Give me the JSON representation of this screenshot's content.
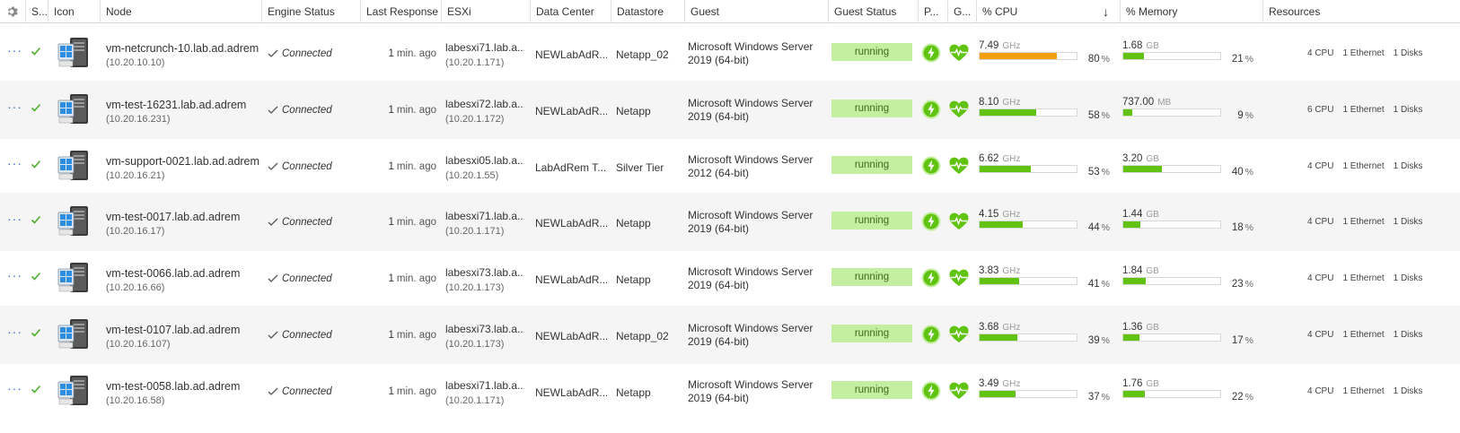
{
  "columns": {
    "s": "S...",
    "icon": "Icon",
    "node": "Node",
    "engine_status": "Engine Status",
    "last_response": "Last Response",
    "esxi": "ESXi",
    "data_center": "Data Center",
    "datastore": "Datastore",
    "guest": "Guest",
    "guest_status": "Guest Status",
    "p": "P...",
    "g": "G...",
    "cpu": "% CPU",
    "memory": "% Memory",
    "resources": "Resources"
  },
  "colors": {
    "bar_normal": "#5fc30f",
    "bar_warning": "#f29f10",
    "running_bg": "#c4eea0",
    "accent_green": "#5fc30f"
  },
  "row_menu_glyph": "···",
  "rows": [
    {
      "node_name": "vm-netcrunch-10.lab.ad.adrem",
      "node_ip": "(10.20.10.10)",
      "engine_status": "Connected",
      "last_response_num": "1",
      "last_response_unit": "min. ago",
      "esxi_name": "labesxi71.lab.a...",
      "esxi_ip": "(10.20.1.171)",
      "data_center": "NEWLabAdR...",
      "datastore": "Netapp_02",
      "guest_line1": "Microsoft Windows Server",
      "guest_line2": "2019 (64-bit)",
      "guest_status": "running",
      "cpu_value": "7.49",
      "cpu_unit": "GHz",
      "cpu_pct": "80",
      "cpu_level": 0.8,
      "cpu_warn": true,
      "mem_value": "1.68",
      "mem_unit": "GB",
      "mem_pct": "21",
      "mem_level": 0.21,
      "res_cpu": "4 CPU",
      "res_eth": "1 Ethernet",
      "res_disk": "1 Disks"
    },
    {
      "node_name": "vm-test-16231.lab.ad.adrem",
      "node_ip": "(10.20.16.231)",
      "engine_status": "Connected",
      "last_response_num": "1",
      "last_response_unit": "min. ago",
      "esxi_name": "labesxi72.lab.a...",
      "esxi_ip": "(10.20.1.172)",
      "data_center": "NEWLabAdR...",
      "datastore": "Netapp",
      "guest_line1": "Microsoft Windows Server",
      "guest_line2": "2019 (64-bit)",
      "guest_status": "running",
      "cpu_value": "8.10",
      "cpu_unit": "GHz",
      "cpu_pct": "58",
      "cpu_level": 0.58,
      "cpu_warn": false,
      "mem_value": "737.00",
      "mem_unit": "MB",
      "mem_pct": "9",
      "mem_level": 0.09,
      "res_cpu": "6 CPU",
      "res_eth": "1 Ethernet",
      "res_disk": "1 Disks"
    },
    {
      "node_name": "vm-support-0021.lab.ad.adrem",
      "node_ip": "(10.20.16.21)",
      "engine_status": "Connected",
      "last_response_num": "1",
      "last_response_unit": "min. ago",
      "esxi_name": "labesxi05.lab.a...",
      "esxi_ip": "(10.20.1.55)",
      "data_center": "LabAdRem T...",
      "datastore": "Silver Tier",
      "guest_line1": "Microsoft Windows Server",
      "guest_line2": "2012 (64-bit)",
      "guest_status": "running",
      "cpu_value": "6.62",
      "cpu_unit": "GHz",
      "cpu_pct": "53",
      "cpu_level": 0.53,
      "cpu_warn": false,
      "mem_value": "3.20",
      "mem_unit": "GB",
      "mem_pct": "40",
      "mem_level": 0.4,
      "res_cpu": "4 CPU",
      "res_eth": "1 Ethernet",
      "res_disk": "1 Disks"
    },
    {
      "node_name": "vm-test-0017.lab.ad.adrem",
      "node_ip": "(10.20.16.17)",
      "engine_status": "Connected",
      "last_response_num": "1",
      "last_response_unit": "min. ago",
      "esxi_name": "labesxi71.lab.a...",
      "esxi_ip": "(10.20.1.171)",
      "data_center": "NEWLabAdR...",
      "datastore": "Netapp",
      "guest_line1": "Microsoft Windows Server",
      "guest_line2": "2019 (64-bit)",
      "guest_status": "running",
      "cpu_value": "4.15",
      "cpu_unit": "GHz",
      "cpu_pct": "44",
      "cpu_level": 0.44,
      "cpu_warn": false,
      "mem_value": "1.44",
      "mem_unit": "GB",
      "mem_pct": "18",
      "mem_level": 0.18,
      "res_cpu": "4 CPU",
      "res_eth": "1 Ethernet",
      "res_disk": "1 Disks"
    },
    {
      "node_name": "vm-test-0066.lab.ad.adrem",
      "node_ip": "(10.20.16.66)",
      "engine_status": "Connected",
      "last_response_num": "1",
      "last_response_unit": "min. ago",
      "esxi_name": "labesxi73.lab.a...",
      "esxi_ip": "(10.20.1.173)",
      "data_center": "NEWLabAdR...",
      "datastore": "Netapp",
      "guest_line1": "Microsoft Windows Server",
      "guest_line2": "2019 (64-bit)",
      "guest_status": "running",
      "cpu_value": "3.83",
      "cpu_unit": "GHz",
      "cpu_pct": "41",
      "cpu_level": 0.41,
      "cpu_warn": false,
      "mem_value": "1.84",
      "mem_unit": "GB",
      "mem_pct": "23",
      "mem_level": 0.23,
      "res_cpu": "4 CPU",
      "res_eth": "1 Ethernet",
      "res_disk": "1 Disks"
    },
    {
      "node_name": "vm-test-0107.lab.ad.adrem",
      "node_ip": "(10.20.16.107)",
      "engine_status": "Connected",
      "last_response_num": "1",
      "last_response_unit": "min. ago",
      "esxi_name": "labesxi73.lab.a...",
      "esxi_ip": "(10.20.1.173)",
      "data_center": "NEWLabAdR...",
      "datastore": "Netapp_02",
      "guest_line1": "Microsoft Windows Server",
      "guest_line2": "2019 (64-bit)",
      "guest_status": "running",
      "cpu_value": "3.68",
      "cpu_unit": "GHz",
      "cpu_pct": "39",
      "cpu_level": 0.39,
      "cpu_warn": false,
      "mem_value": "1.36",
      "mem_unit": "GB",
      "mem_pct": "17",
      "mem_level": 0.17,
      "res_cpu": "4 CPU",
      "res_eth": "1 Ethernet",
      "res_disk": "1 Disks"
    },
    {
      "node_name": "vm-test-0058.lab.ad.adrem",
      "node_ip": "(10.20.16.58)",
      "engine_status": "Connected",
      "last_response_num": "1",
      "last_response_unit": "min. ago",
      "esxi_name": "labesxi71.lab.a...",
      "esxi_ip": "(10.20.1.171)",
      "data_center": "NEWLabAdR...",
      "datastore": "Netapp",
      "guest_line1": "Microsoft Windows Server",
      "guest_line2": "2019 (64-bit)",
      "guest_status": "running",
      "cpu_value": "3.49",
      "cpu_unit": "GHz",
      "cpu_pct": "37",
      "cpu_level": 0.37,
      "cpu_warn": false,
      "mem_value": "1.76",
      "mem_unit": "GB",
      "mem_pct": "22",
      "mem_level": 0.22,
      "res_cpu": "4 CPU",
      "res_eth": "1 Ethernet",
      "res_disk": "1 Disks"
    }
  ]
}
